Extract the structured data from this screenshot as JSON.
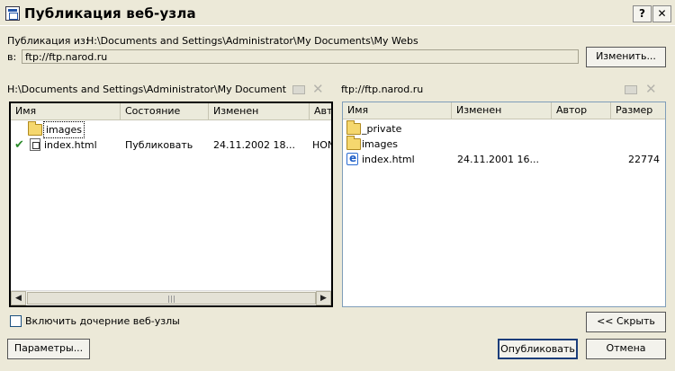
{
  "window": {
    "title": "Публикация веб-узла",
    "help_glyph": "?",
    "close_glyph": "✕"
  },
  "publish_from": {
    "label": "Публикация из:",
    "value": "H:\\Documents and Settings\\Administrator\\My Documents\\My Webs"
  },
  "publish_to": {
    "label": "в:",
    "value": "ftp://ftp.narod.ru",
    "change_button": "Изменить..."
  },
  "left_pane": {
    "path": "H:\\Documents and Settings\\Administrator\\My Documents\\My ...",
    "columns": [
      "Имя",
      "Состояние",
      "Изменен",
      "Автор"
    ],
    "rows": [
      {
        "icon": "folder-icon",
        "name": "images",
        "status": "",
        "modified": "",
        "author": "",
        "mark": ""
      },
      {
        "icon": "html-file-icon",
        "name": "index.html",
        "status": "Публиковать",
        "modified": "24.11.2002 18...",
        "author": "HON",
        "mark": "✔"
      }
    ]
  },
  "right_pane": {
    "path": "ftp://ftp.narod.ru",
    "columns": [
      "Имя",
      "Изменен",
      "Автор",
      "Размер"
    ],
    "rows": [
      {
        "icon": "folder-icon",
        "name": "_private",
        "modified": "",
        "author": "",
        "size": ""
      },
      {
        "icon": "folder-icon",
        "name": "images",
        "modified": "",
        "author": "",
        "size": ""
      },
      {
        "icon": "ie-file-icon",
        "name": "index.html",
        "modified": "24.11.2001 16...",
        "author": "",
        "size": "22774"
      }
    ]
  },
  "subwebs_checkbox": {
    "label": "Включить дочерние веб-узлы",
    "checked": false
  },
  "buttons": {
    "hide": "<< Скрыть",
    "options": "Параметры...",
    "publish": "Опубликовать",
    "cancel": "Отмена"
  },
  "scrollbar": {
    "left_arrow": "◀",
    "right_arrow": "▶"
  }
}
